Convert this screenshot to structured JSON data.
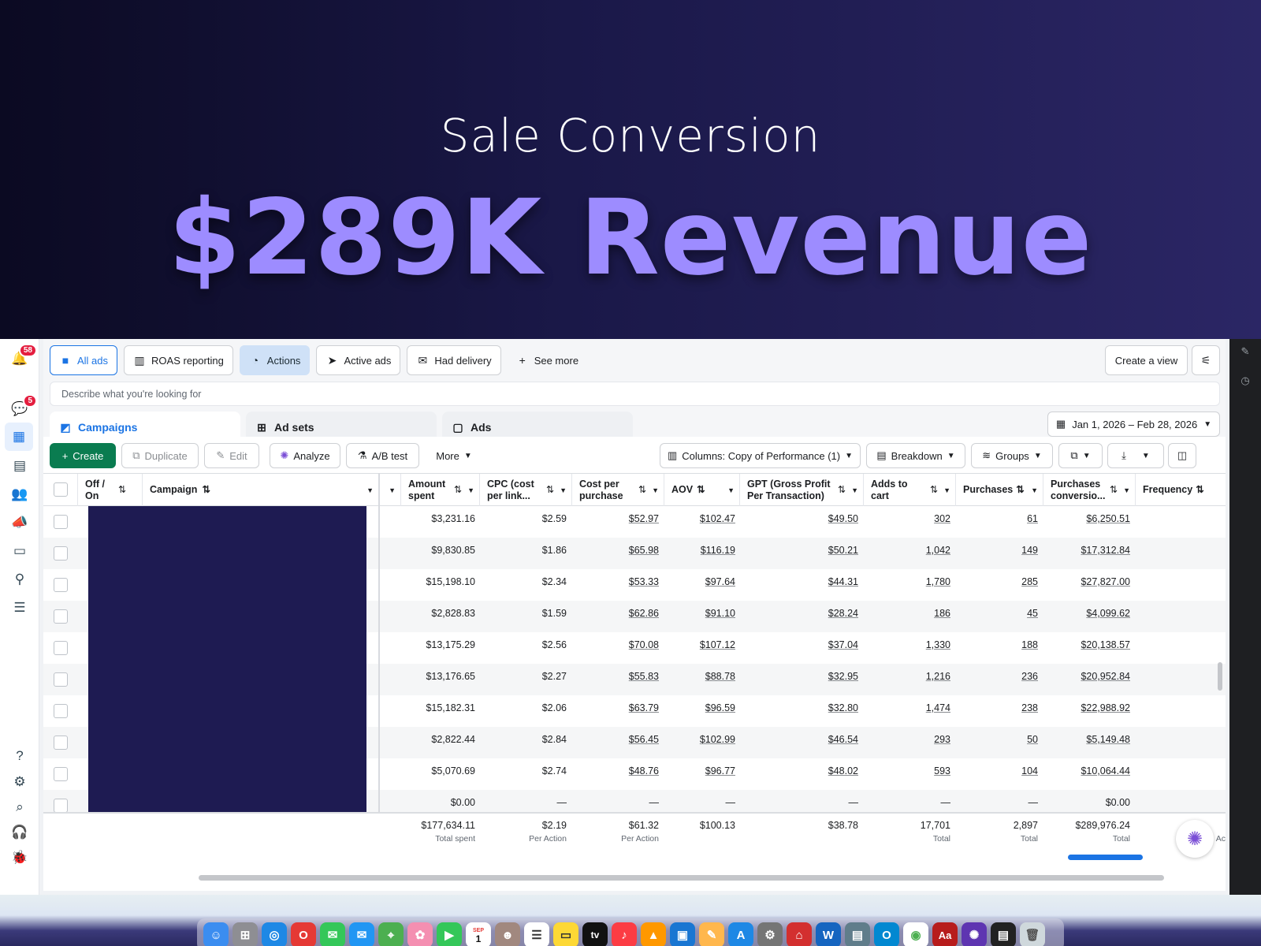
{
  "hero": {
    "subtitle": "Sale Conversion",
    "headline": "$289K Revenue"
  },
  "rail": {
    "notif_badge": "58",
    "msg_badge": "5",
    "help": "?"
  },
  "view_tabs": [
    {
      "label": "All ads",
      "icon": "folder-icon"
    },
    {
      "label": "ROAS reporting",
      "icon": "report-icon"
    },
    {
      "label": "Actions",
      "icon": "actions-icon"
    },
    {
      "label": "Active ads",
      "icon": "send-icon"
    },
    {
      "label": "Had delivery",
      "icon": "envelope-icon"
    },
    {
      "label": "See more",
      "icon": "plus-icon"
    }
  ],
  "create_view": "Create a view",
  "search_placeholder": "Describe what you're looking for",
  "level_tabs": {
    "campaigns": "Campaigns",
    "adsets": "Ad sets",
    "ads": "Ads"
  },
  "date_range": "Jan 1, 2026 – Feb 28, 2026",
  "toolbar": {
    "create": "Create",
    "duplicate": "Duplicate",
    "edit": "Edit",
    "analyze": "Analyze",
    "abtest": "A/B test",
    "more": "More",
    "columns": "Columns: Copy of Performance (1)",
    "breakdown": "Breakdown",
    "groups": "Groups"
  },
  "headers": {
    "offon": "Off / On",
    "campaign": "Campaign",
    "amount": "Amount spent",
    "cpc": "CPC (cost per link...",
    "cpp": "Cost per purchase",
    "aov": "AOV",
    "gpt": "GPT (Gross Profit Per Transaction)",
    "atc": "Adds to cart",
    "purchases": "Purchases",
    "pcv": "Purchases conversio...",
    "freq": "Frequency"
  },
  "rows": [
    [
      "$3,231.16",
      "$2.59",
      "$52.97",
      "$102.47",
      "$49.50",
      "302",
      "61",
      "$6,250.51"
    ],
    [
      "$9,830.85",
      "$1.86",
      "$65.98",
      "$116.19",
      "$50.21",
      "1,042",
      "149",
      "$17,312.84"
    ],
    [
      "$15,198.10",
      "$2.34",
      "$53.33",
      "$97.64",
      "$44.31",
      "1,780",
      "285",
      "$27,827.00"
    ],
    [
      "$2,828.83",
      "$1.59",
      "$62.86",
      "$91.10",
      "$28.24",
      "186",
      "45",
      "$4,099.62"
    ],
    [
      "$13,175.29",
      "$2.56",
      "$70.08",
      "$107.12",
      "$37.04",
      "1,330",
      "188",
      "$20,138.57"
    ],
    [
      "$13,176.65",
      "$2.27",
      "$55.83",
      "$88.78",
      "$32.95",
      "1,216",
      "236",
      "$20,952.84"
    ],
    [
      "$15,182.31",
      "$2.06",
      "$63.79",
      "$96.59",
      "$32.80",
      "1,474",
      "238",
      "$22,988.92"
    ],
    [
      "$2,822.44",
      "$2.84",
      "$56.45",
      "$102.99",
      "$46.54",
      "293",
      "50",
      "$5,149.48"
    ],
    [
      "$5,070.69",
      "$2.74",
      "$48.76",
      "$96.77",
      "$48.02",
      "593",
      "104",
      "$10,064.44"
    ],
    [
      "$0.00",
      "—",
      "—",
      "—",
      "—",
      "—",
      "—",
      "$0.00"
    ]
  ],
  "totals": {
    "amount": "$177,634.11",
    "amount_sub": "Total spent",
    "cpc": "$2.19",
    "cpc_sub": "Per Action",
    "cpp": "$61.32",
    "cpp_sub": "Per Action",
    "aov": "$100.13",
    "gpt": "$38.78",
    "atc": "17,701",
    "atc_sub": "Total",
    "purchases": "2,897",
    "purchases_sub": "Total",
    "pcv": "$289,976.24",
    "pcv_sub": "Total",
    "freq_partial": "Ac"
  },
  "dock": {
    "calendar_day": "1",
    "calendar_month": "SEP",
    "tv_label": "tv",
    "dict_label": "Aa",
    "word_label": "W",
    "outlook_label": "O"
  },
  "colors": {
    "accent": "#1b74e4",
    "hero_headline": "#9d8cff",
    "create_green": "#0a7c50",
    "redaction": "#1e1b52"
  }
}
